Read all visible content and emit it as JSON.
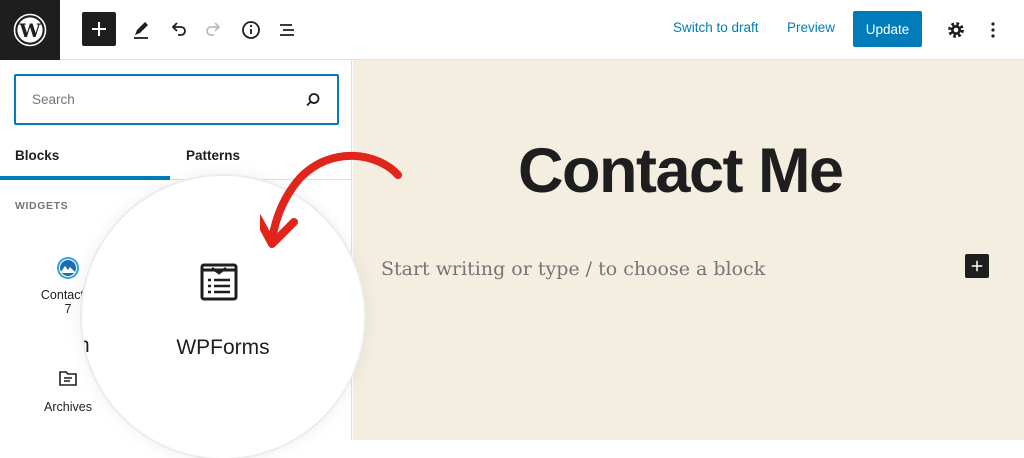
{
  "toolbar": {
    "switch_to_draft": "Switch to draft",
    "preview": "Preview",
    "update": "Update"
  },
  "sidebar": {
    "search_placeholder": "Search",
    "tabs": [
      "Blocks",
      "Patterns"
    ],
    "section_label": "WIDGETS",
    "items": [
      {
        "label_line1": "Contact F",
        "label_line2": "7",
        "icon": "contact-form-7-icon"
      },
      {
        "label": "Archives",
        "icon": "archive-folder-icon"
      }
    ]
  },
  "canvas": {
    "title": "Contact Me",
    "placeholder": "Start writing or type / to choose a block"
  },
  "magnifier": {
    "label": "WPForms",
    "partial_text": "n",
    "icon": "wpforms-icon"
  },
  "colors": {
    "accent": "#007cba",
    "canvas_bg": "#f4eee0",
    "dark": "#1e1e1e",
    "arrow": "#e1251b"
  }
}
